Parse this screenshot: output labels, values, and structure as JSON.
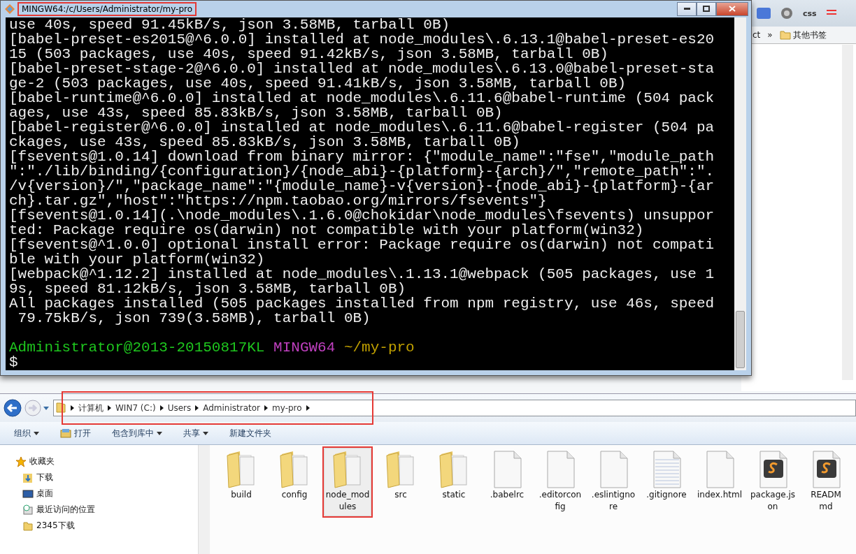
{
  "terminal": {
    "title": "MINGW64:/c/Users/Administrator/my-pro",
    "title_highlighted": true,
    "lines": [
      "use 40s, speed 91.45kB/s, json 3.58MB, tarball 0B)",
      "[babel-preset-es2015@^6.0.0] installed at node_modules\\.6.13.1@babel-preset-es20",
      "15 (503 packages, use 40s, speed 91.42kB/s, json 3.58MB, tarball 0B)",
      "[babel-preset-stage-2@^6.0.0] installed at node_modules\\.6.13.0@babel-preset-sta",
      "ge-2 (503 packages, use 40s, speed 91.41kB/s, json 3.58MB, tarball 0B)",
      "[babel-runtime@^6.0.0] installed at node_modules\\.6.11.6@babel-runtime (504 pack",
      "ages, use 43s, speed 85.83kB/s, json 3.58MB, tarball 0B)",
      "[babel-register@^6.0.0] installed at node_modules\\.6.11.6@babel-register (504 pa",
      "ckages, use 43s, speed 85.83kB/s, json 3.58MB, tarball 0B)",
      "[fsevents@1.0.14] download from binary mirror: {\"module_name\":\"fse\",\"module_path",
      "\":\"./lib/binding/{configuration}/{node_abi}-{platform}-{arch}/\",\"remote_path\":\".",
      "/v{version}/\",\"package_name\":\"{module_name}-v{version}-{node_abi}-{platform}-{ar",
      "ch}.tar.gz\",\"host\":\"https://npm.taobao.org/mirrors/fsevents\"}",
      "[fsevents@1.0.14](.\\node_modules\\.1.6.0@chokidar\\node_modules\\fsevents) unsuppor",
      "ted: Package require os(darwin) not compatible with your platform(win32)",
      "[fsevents@^1.0.0] optional install error: Package require os(darwin) not compati",
      "ble with your platform(win32)",
      "[webpack@^1.12.2] installed at node_modules\\.1.13.1@webpack (505 packages, use 1",
      "9s, speed 81.12kB/s, json 3.58MB, tarball 0B)",
      "All packages installed (505 packages installed from npm registry, use 46s, speed",
      " 79.75kB/s, json 739(3.58MB), tarball 0B)"
    ],
    "prompt": {
      "user": "Administrator@2013-20150817KL",
      "system": "MINGW64",
      "path": "~/my-pro"
    },
    "input": "$"
  },
  "browser": {
    "extension_label": "css",
    "bookmarks": [
      {
        "label": "ct",
        "kind": "text"
      },
      {
        "label": "»",
        "kind": "text"
      },
      {
        "label": "其他书签",
        "kind": "folder"
      }
    ]
  },
  "explorer": {
    "breadcrumbs": [
      "计算机",
      "WIN7 (C:)",
      "Users",
      "Administrator",
      "my-pro"
    ],
    "address_highlighted": true,
    "toolbar": [
      {
        "label": "组织",
        "kind": "dropdown"
      },
      {
        "label": "打开",
        "kind": "icon"
      },
      {
        "label": "包含到库中",
        "kind": "dropdown"
      },
      {
        "label": "共享",
        "kind": "dropdown"
      },
      {
        "label": "新建文件夹",
        "kind": "plain"
      }
    ],
    "sidebar": [
      {
        "label": "收藏夹",
        "kind": "favorites",
        "children": [
          {
            "label": "下载",
            "kind": "download"
          },
          {
            "label": "桌面",
            "kind": "desktop"
          },
          {
            "label": "最近访问的位置",
            "kind": "recent"
          },
          {
            "label": "2345下载",
            "kind": "folder"
          }
        ]
      }
    ],
    "files": [
      {
        "lines": [
          "build"
        ],
        "kind": "folder",
        "selected": false,
        "highlighted": false
      },
      {
        "lines": [
          "config"
        ],
        "kind": "folder",
        "selected": false,
        "highlighted": false
      },
      {
        "lines": [
          "node_mod",
          "ules"
        ],
        "kind": "folder",
        "selected": true,
        "highlighted": true
      },
      {
        "lines": [
          "src"
        ],
        "kind": "folder",
        "selected": false,
        "highlighted": false
      },
      {
        "lines": [
          "static"
        ],
        "kind": "folder",
        "selected": false,
        "highlighted": false
      },
      {
        "lines": [
          ".babelrc"
        ],
        "kind": "file",
        "selected": false,
        "highlighted": false
      },
      {
        "lines": [
          ".editorcon",
          "fig"
        ],
        "kind": "file",
        "selected": false,
        "highlighted": false
      },
      {
        "lines": [
          ".eslintigno",
          "re"
        ],
        "kind": "file",
        "selected": false,
        "highlighted": false
      },
      {
        "lines": [
          ".gitignore"
        ],
        "kind": "text",
        "selected": false,
        "highlighted": false
      },
      {
        "lines": [
          "index.html"
        ],
        "kind": "file",
        "selected": false,
        "highlighted": false
      },
      {
        "lines": [
          "package.js",
          "on"
        ],
        "kind": "sublime",
        "selected": false,
        "highlighted": false
      },
      {
        "lines": [
          "READM",
          "md"
        ],
        "kind": "sublime",
        "selected": false,
        "highlighted": false
      }
    ]
  }
}
